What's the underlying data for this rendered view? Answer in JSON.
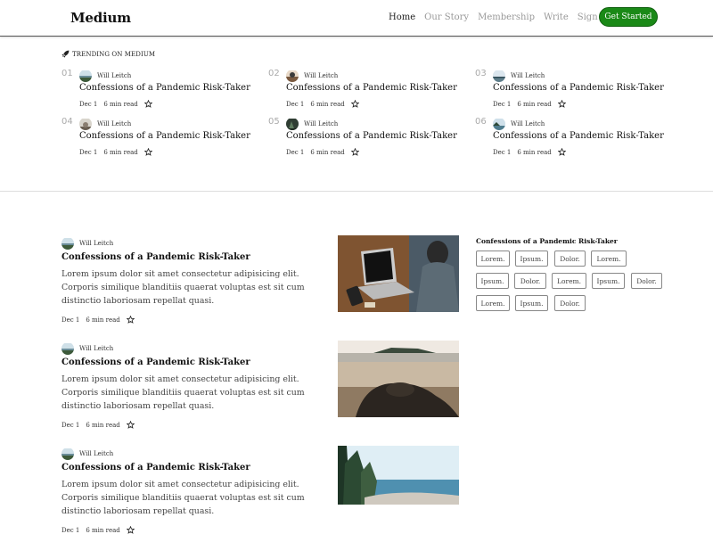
{
  "brand": "Medium",
  "nav": {
    "links": [
      "Home",
      "Our Story",
      "Membership",
      "Write",
      "Sign In"
    ],
    "cta": "Get Started"
  },
  "trending": {
    "heading": "TRENDING ON MEDIUM",
    "items": [
      {
        "num": "01",
        "author": "Will Leitch",
        "title": "Confessions of a Pandemic Risk-Taker",
        "date": "Dec 1",
        "read": "6 min read"
      },
      {
        "num": "02",
        "author": "Will Leitch",
        "title": "Confessions of a Pandemic Risk-Taker",
        "date": "Dec 1",
        "read": "6 min read"
      },
      {
        "num": "03",
        "author": "Will Leitch",
        "title": "Confessions of a Pandemic Risk-Taker",
        "date": "Dec 1",
        "read": "6 min read"
      },
      {
        "num": "04",
        "author": "Will Leitch",
        "title": "Confessions of a Pandemic Risk-Taker",
        "date": "Dec 1",
        "read": "6 min read"
      },
      {
        "num": "05",
        "author": "Will Leitch",
        "title": "Confessions of a Pandemic Risk-Taker",
        "date": "Dec 1",
        "read": "6 min read"
      },
      {
        "num": "06",
        "author": "Will Leitch",
        "title": "Confessions of a Pandemic Risk-Taker",
        "date": "Dec 1",
        "read": "6 min read"
      }
    ]
  },
  "posts": [
    {
      "author": "Will Leitch",
      "title": "Confessions of a Pandemic Risk-Taker",
      "excerpt": "Lorem ipsum dolor sit amet consectetur adipisicing elit. Corporis similique blanditiis quaerat voluptas est sit cum distinctio laboriosam repellat quasi.",
      "date": "Dec 1",
      "read": "6 min read",
      "image": "laptop-photo"
    },
    {
      "author": "Will Leitch",
      "title": "Confessions of a Pandemic Risk-Taker",
      "excerpt": "Lorem ipsum dolor sit amet consectetur adipisicing elit. Corporis similique blanditiis quaerat voluptas est sit cum distinctio laboriosam repellat quasi.",
      "date": "Dec 1",
      "read": "6 min read",
      "image": "beach-rocks-photo"
    },
    {
      "author": "Will Leitch",
      "title": "Confessions of a Pandemic Risk-Taker",
      "excerpt": "Lorem ipsum dolor sit amet consectetur adipisicing elit. Corporis similique blanditiis quaerat voluptas est sit cum distinctio laboriosam repellat quasi.",
      "date": "Dec 1",
      "read": "6 min read",
      "image": "coast-trees-photo"
    }
  ],
  "sidebar": {
    "title": "Confessions of a Pandemic Risk-Taker",
    "tags": [
      "Lorem.",
      "Ipsum.",
      "Dolor.",
      "Lorem.",
      "Ipsum.",
      "Dolor.",
      "Lorem.",
      "Ipsum.",
      "Dolor.",
      "Lorem.",
      "Ipsum.",
      "Dolor."
    ]
  },
  "colors": {
    "accent": "#1a8917",
    "text": "#111111",
    "muted": "#999999"
  },
  "icons": {
    "trending": "rocket-icon",
    "bookmark": "star-icon"
  }
}
